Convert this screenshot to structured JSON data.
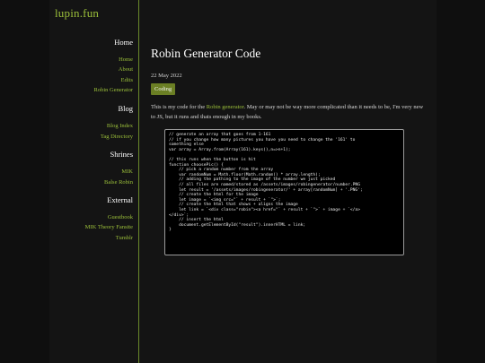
{
  "site": {
    "title": "lupin.fun"
  },
  "nav": {
    "home_heading": "Home",
    "home_links": [
      "Home",
      "About",
      "Edits",
      "Robin Generator"
    ],
    "blog_heading": "Blog",
    "blog_links": [
      "Blog Index",
      "Tag Directory"
    ],
    "shrines_heading": "Shrines",
    "shrines_links": [
      "MIK",
      "Balse Robin"
    ],
    "external_heading": "External",
    "external_links": [
      "Guestbook",
      "MIK Theory Fansite",
      "Tumblr"
    ]
  },
  "post": {
    "title": "Robin Generator Code",
    "date": "22 May 2022",
    "tag": "Coding",
    "intro_before": "This is my code for the ",
    "intro_link": "Robin generator",
    "intro_after": ". May or may not be way more complicated than it needs to be, I'm very new to JS, but it runs and thats enough in my books.",
    "code": "// generate an array that goes from 1-161\n// if you change how many pictures you have you need to change the '161' to\nsomething else\nvar array = Array.from(Array(161).keys(),n=>n+1);\n\n// this runs when the button is hit\nfunction choosePic() {\n    // pick a random number from the array\n    var randomNum = Math.floor(Math.random() * array.length);\n    // adding the pathing to the image of the number we just picked\n    // all files are named/stored as /assets/images/robingenerator/number.PNG\n    let result = '/assets/images/robingenerator/' + array[randomNum] + '.PNG';\n    // create the html for the image\n    let image = `<img src=\"` + result + `\">`;\n    // create the html that shows + aligns the image\n    let link = `<div class=\"robin\"><a href=\"` + result + `\">` + image + `</a>\n</div>`;\n    // insert the html\n    document.getElementById(\"result\").innerHTML = link;\n}"
  }
}
